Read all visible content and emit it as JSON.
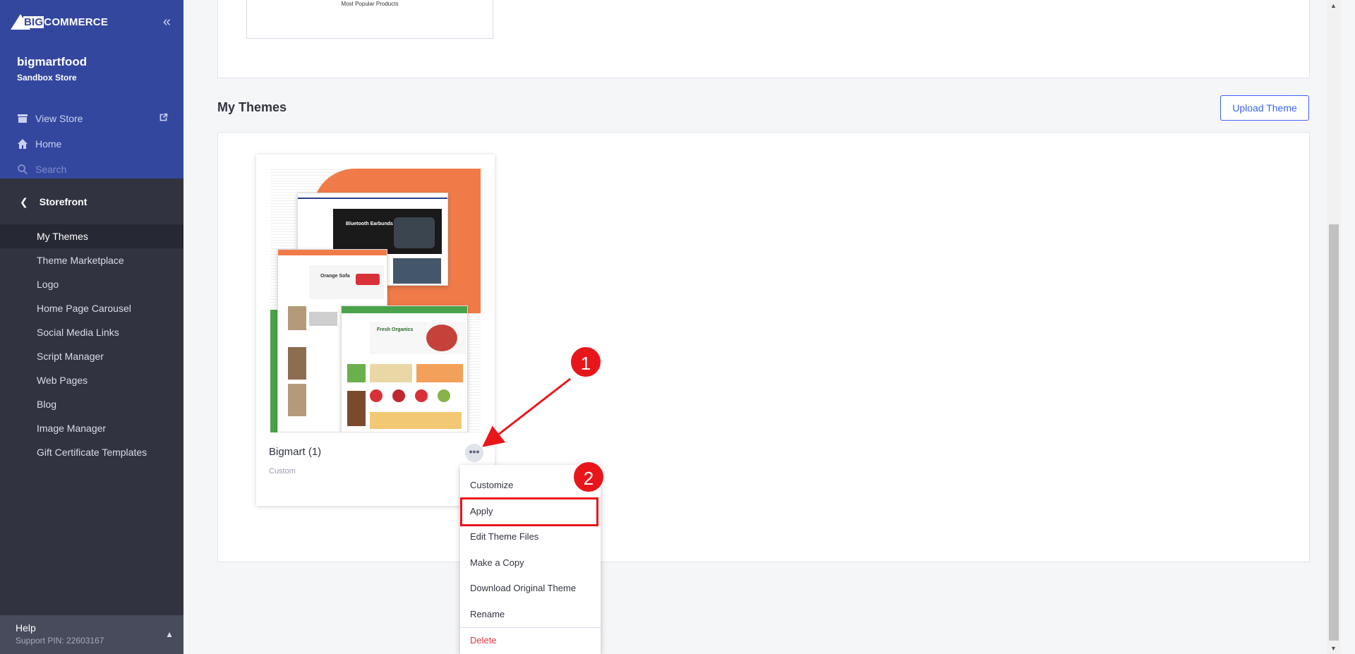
{
  "sidebar": {
    "brand": "BIGCOMMERCE",
    "brand_big": "BIG",
    "brand_rest": "COMMERCE",
    "store_name": "bigmartfood",
    "store_type": "Sandbox Store",
    "top_nav": [
      {
        "label": "View Store",
        "icon": "store-icon"
      },
      {
        "label": "Home",
        "icon": "home-icon"
      },
      {
        "label": "Search",
        "icon": "search-icon"
      }
    ],
    "section": "Storefront",
    "items": [
      {
        "label": "My Themes",
        "active": true
      },
      {
        "label": "Theme Marketplace"
      },
      {
        "label": "Logo"
      },
      {
        "label": "Home Page Carousel"
      },
      {
        "label": "Social Media Links"
      },
      {
        "label": "Script Manager"
      },
      {
        "label": "Web Pages"
      },
      {
        "label": "Blog"
      },
      {
        "label": "Image Manager"
      },
      {
        "label": "Gift Certificate Templates"
      }
    ],
    "help_title": "Help",
    "help_pin": "Support PIN: 22603167"
  },
  "main": {
    "top_thumb_caption": "Most Popular Products",
    "section_title": "My Themes",
    "upload_label": "Upload Theme",
    "theme": {
      "name": "Bigmart (1)",
      "type": "Custom",
      "preview_text": {
        "earbuds": "Bluetooth Earbunds",
        "sofa": "Orange Sofa",
        "organics": "Fresh Organics"
      }
    },
    "menu": [
      "Customize",
      "Apply",
      "Edit Theme Files",
      "Make a Copy",
      "Download Original Theme",
      "Rename",
      "Delete"
    ]
  },
  "annotations": {
    "step1": "1",
    "step2": "2"
  },
  "colors": {
    "sidebar_top": "#34479f",
    "sidebar": "#313440",
    "accent": "#3c64f4",
    "highlight": "#e8161b",
    "delete": "#db3643"
  }
}
